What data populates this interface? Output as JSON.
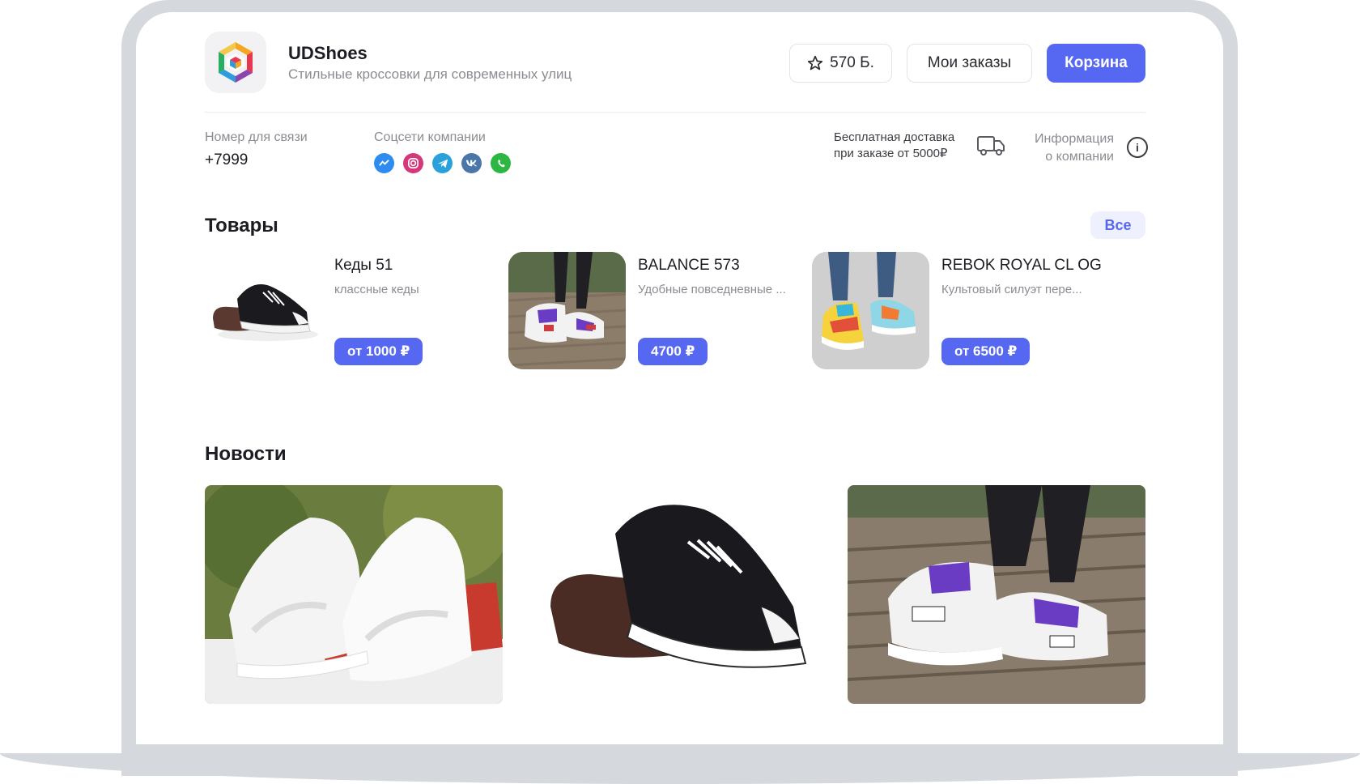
{
  "header": {
    "brand_name": "UDShoes",
    "brand_tagline": "Стильные кроссовки для современных улиц",
    "points_label": "570 Б.",
    "orders_label": "Мои заказы",
    "cart_label": "Корзина"
  },
  "contacts": {
    "phone_label": "Номер для связи",
    "phone_value": "+7999",
    "socials_label": "Соцсети компании",
    "socials": [
      "messenger-icon",
      "instagram-icon",
      "telegram-icon",
      "vk-icon",
      "whatsapp-icon"
    ],
    "delivery_line1": "Бесплатная доставка",
    "delivery_line2": "при заказе от 5000₽",
    "info_line1": "Информация",
    "info_line2": "о компании"
  },
  "products": {
    "title": "Товары",
    "all_label": "Все",
    "items": [
      {
        "name": "Кеды 51",
        "description": "классные кеды",
        "price": "от 1000 ₽"
      },
      {
        "name": "BALANCE 573",
        "description": "Удобные повседневные ...",
        "price": "4700 ₽"
      },
      {
        "name": "REBOK ROYAL CL OG",
        "description": "Культовый силуэт пере...",
        "price": "от 6500 ₽"
      }
    ]
  },
  "news": {
    "title": "Новости"
  },
  "colors": {
    "accent": "#5667f1",
    "frame": "#d5d9de"
  }
}
